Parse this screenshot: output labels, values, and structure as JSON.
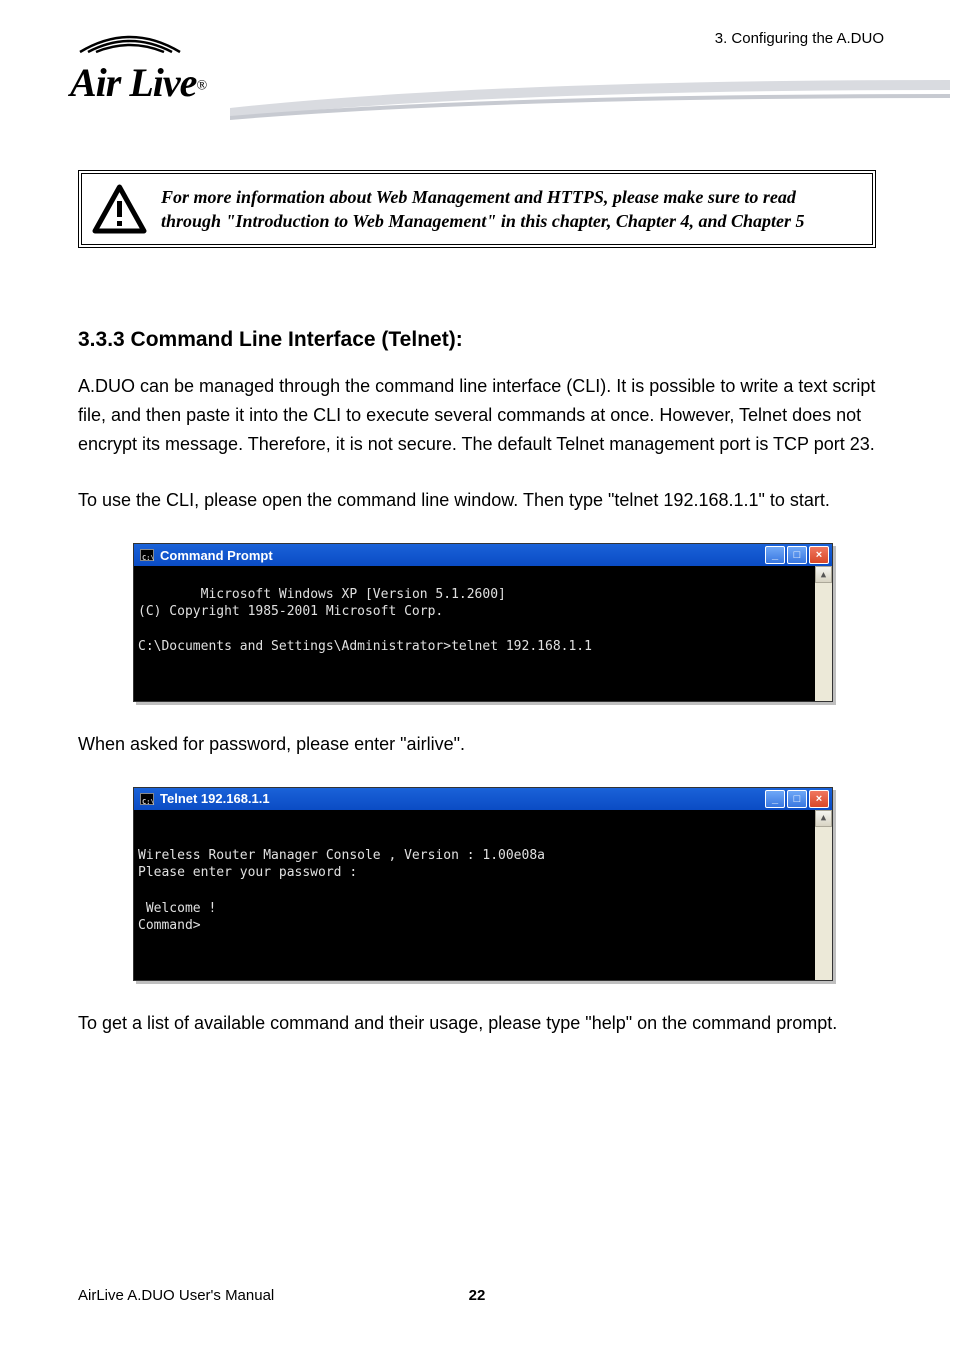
{
  "header": {
    "chapter_ref": "3. Configuring the A.DUO",
    "logo_text": "Air Live",
    "reg_mark": "®"
  },
  "warning": {
    "text": "For more information about Web Management and HTTPS, please make sure to read through \"Introduction to Web Management\" in this chapter, Chapter 4, and Chapter 5"
  },
  "section": {
    "heading": "3.3.3 Command Line Interface (Telnet):",
    "para1": "A.DUO can be managed through the command line interface (CLI). It is possible to write a text script file, and then paste it into the CLI to execute several commands at once. However, Telnet does not encrypt its message. Therefore, it is not secure. The default Telnet management port is TCP port 23.",
    "para2": "To use the CLI, please open the command line window. Then type \"telnet 192.168.1.1\" to start.",
    "para3": "When asked for password, please enter \"airlive\".",
    "para4": "To get a list of available command and their usage, please type \"help\" on the command prompt."
  },
  "console1": {
    "title": "Command Prompt",
    "body": "Microsoft Windows XP [Version 5.1.2600]\n(C) Copyright 1985-2001 Microsoft Corp.\n\nC:\\Documents and Settings\\Administrator>telnet 192.168.1.1"
  },
  "console2": {
    "title": "Telnet 192.168.1.1",
    "body": "\nWireless Router Manager Console , Version : 1.00e08a\nPlease enter your password :\n\n Welcome !\nCommand>"
  },
  "window_controls": {
    "minimize": "_",
    "maximize": "□",
    "close": "×",
    "scroll_up": "▲"
  },
  "footer": {
    "manual": "AirLive A.DUO User's Manual",
    "page": "22"
  }
}
